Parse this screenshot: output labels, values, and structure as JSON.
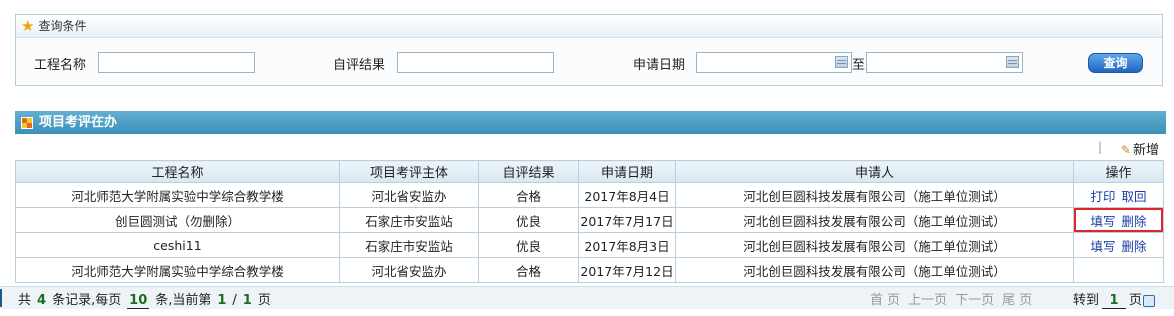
{
  "query": {
    "header": "查询条件",
    "fields": {
      "project_name_label": "工程名称",
      "self_eval_label": "自评结果",
      "apply_date_label": "申请日期",
      "to_label": "至"
    },
    "values": {
      "project_name": "",
      "self_eval": "",
      "date_from": "",
      "date_to": ""
    },
    "search_button": "查询"
  },
  "list": {
    "title": "项目考评在办",
    "new_button": "新增",
    "columns": [
      "工程名称",
      "项目考评主体",
      "自评结果",
      "申请日期",
      "申请人",
      "操作"
    ],
    "rows": [
      {
        "name": "河北师范大学附属实验中学综合教学楼",
        "subject": "河北省安监办",
        "result": "合格",
        "date": "2017年8月4日",
        "applicant": "河北创巨圆科技发展有限公司（施工单位测试）",
        "op1": "打印",
        "op2": "取回"
      },
      {
        "name": "创巨圆测试（勿删除）",
        "subject": "石家庄市安监站",
        "result": "优良",
        "date": "2017年7月17日",
        "applicant": "河北创巨圆科技发展有限公司（施工单位测试）",
        "op1": "填写",
        "op2": "删除"
      },
      {
        "name": "ceshi11",
        "subject": "石家庄市安监站",
        "result": "优良",
        "date": "2017年8月3日",
        "applicant": "河北创巨圆科技发展有限公司（施工单位测试）",
        "op1": "填写",
        "op2": "删除"
      },
      {
        "name": "河北师范大学附属实验中学综合教学楼",
        "subject": "河北省安监办",
        "result": "合格",
        "date": "2017年7月12日",
        "applicant": "河北创巨圆科技发展有限公司（施工单位测试）",
        "op1": "",
        "op2": ""
      }
    ]
  },
  "pager": {
    "prefix": "共",
    "total": "4",
    "records_text": "条记录,每页",
    "per_page": "10",
    "current_text": "条,当前第",
    "current_page": "1",
    "slash": "/",
    "total_pages": "1",
    "page_suffix": "页",
    "first": "首 页",
    "prev": "上一页",
    "next": "下一页",
    "last": "尾 页",
    "goto_label": "转到",
    "goto_value": "1",
    "goto_suffix": "页"
  },
  "colors": {
    "title_bar": "#3b8fb8",
    "link": "#1a3ea6",
    "highlight": "#e0262a",
    "pager_number": "#1f6b24"
  },
  "icons": [
    "star-icon",
    "calendar-icon",
    "grid-icon",
    "edit-icon",
    "go-icon"
  ]
}
